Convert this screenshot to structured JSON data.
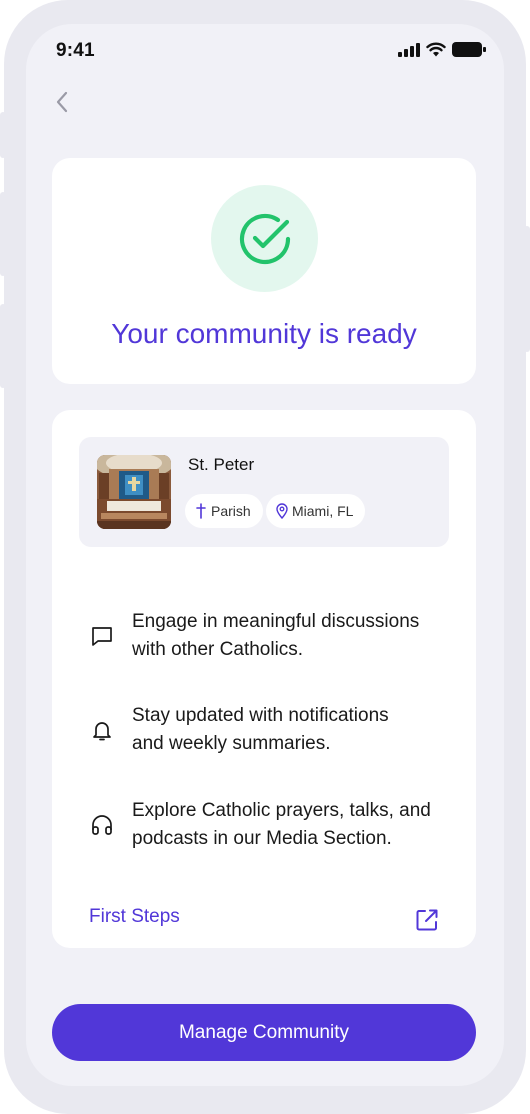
{
  "status_bar": {
    "time": "9:41",
    "icons": [
      "cellular-signal-icon",
      "wifi-icon",
      "battery-icon"
    ]
  },
  "nav": {
    "back_icon": "chevron-left-icon"
  },
  "hero": {
    "icon": "check-circle-icon",
    "title": "Your community is ready"
  },
  "parish": {
    "name": "St. Peter",
    "image": "church-interior-photo",
    "type_chip": {
      "icon": "cross-icon",
      "label": "Parish"
    },
    "location_chip": {
      "icon": "map-pin-icon",
      "label": "Miami, FL"
    }
  },
  "features": [
    {
      "icon": "chat-bubble-icon",
      "text": "Engage in meaningful discussions\nwith other Catholics."
    },
    {
      "icon": "bell-icon",
      "text": "Stay updated with notifications\nand weekly summaries."
    },
    {
      "icon": "headphones-icon",
      "text": "Explore Catholic prayers, talks, and\npodcasts in our Media Section."
    }
  ],
  "links": {
    "first_steps": "First Steps",
    "first_steps_icon": "external-link-icon"
  },
  "actions": {
    "manage_label": "Manage Community"
  },
  "colors": {
    "accent": "#5137d8",
    "success": "#22c36b",
    "success_bg": "#e3f7ee",
    "screen_bg": "#f1f1f7",
    "card_bg": "#ffffff"
  }
}
